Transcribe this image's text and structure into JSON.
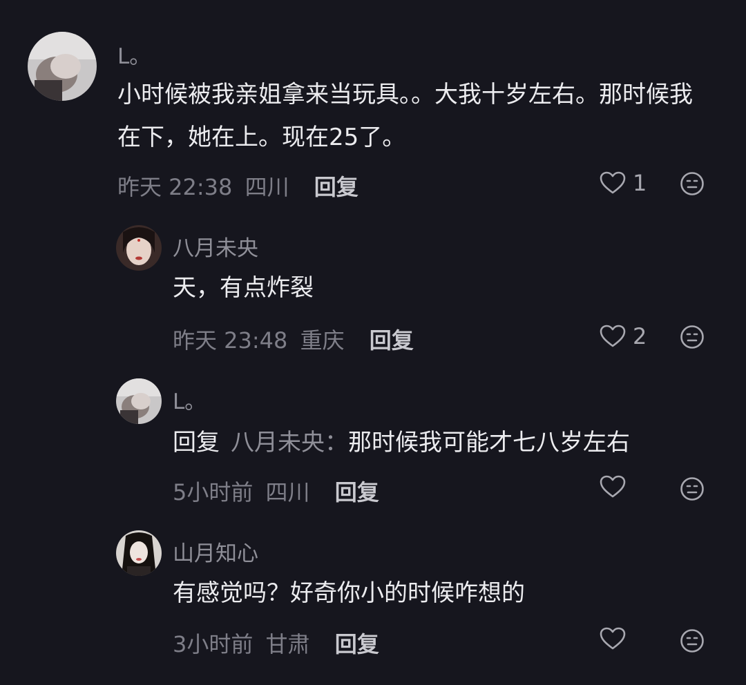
{
  "comments": [
    {
      "username": "L。",
      "content": "小时候被我亲姐拿来当玩具。。大我十岁左右。那时候我在下，她在上。现在25了。",
      "time": "昨天 22:38",
      "location": "四川",
      "reply_label": "回复",
      "likes": "1",
      "avatar_icon": "user-avatar-photo",
      "like_icon": "heart-outline-icon",
      "dislike_icon": "neutral-face-icon"
    },
    {
      "username": "八月未央",
      "content": "天，有点炸裂",
      "time": "昨天 23:48",
      "location": "重庆",
      "reply_label": "回复",
      "likes": "2",
      "avatar_icon": "user-avatar-photo",
      "like_icon": "heart-outline-icon",
      "dislike_icon": "neutral-face-icon"
    },
    {
      "username": "L。",
      "reply_prefix": "回复",
      "reply_to": "八月未央：",
      "content": "那时候我可能才七八岁左右",
      "time": "5小时前",
      "location": "四川",
      "reply_label": "回复",
      "likes": "",
      "avatar_icon": "user-avatar-photo",
      "like_icon": "heart-outline-icon",
      "dislike_icon": "neutral-face-icon"
    },
    {
      "username": "山月知心",
      "content": "有感觉吗？好奇你小的时候咋想的",
      "time": "3小时前",
      "location": "甘肃",
      "reply_label": "回复",
      "likes": "",
      "avatar_icon": "user-avatar-photo",
      "like_icon": "heart-outline-icon",
      "dislike_icon": "neutral-face-icon"
    }
  ],
  "colors": {
    "background": "#16161e",
    "text": "#ececef",
    "muted": "#8f8f98",
    "icon": "#a8a8b0"
  }
}
